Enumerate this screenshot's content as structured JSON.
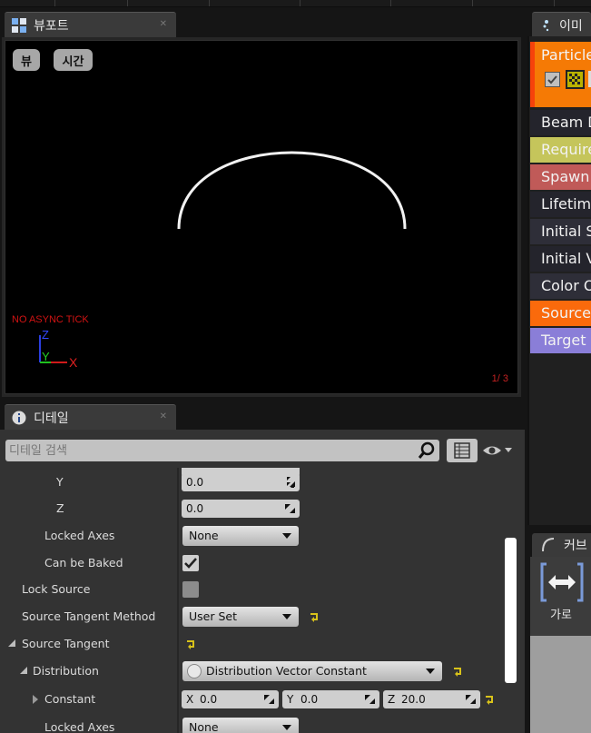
{
  "viewport": {
    "tab_title": "뷰포트",
    "view_button": "뷰",
    "time_button": "시간",
    "overlay_text": "NO ASYNC TICK",
    "axis_z": "Z",
    "axis_y": "Y",
    "axis_x": "X",
    "page_indicator": "1/  3"
  },
  "details": {
    "tab_title": "디테일",
    "search_placeholder": "디테일 검색",
    "rows": {
      "y_label": "Y",
      "y_value": "0.0",
      "z_label": "Z",
      "z_value": "0.0",
      "locked_axes_label": "Locked Axes",
      "locked_axes_value": "None",
      "can_be_baked_label": "Can be Baked",
      "lock_source_label": "Lock Source",
      "source_tangent_method_label": "Source Tangent Method",
      "source_tangent_method_value": "User Set",
      "source_tangent_label": "Source Tangent",
      "distribution_label": "Distribution",
      "distribution_value": "Distribution Vector Constant",
      "constant_label": "Constant",
      "constant_x_label": "X",
      "constant_x": "0.0",
      "constant_y_label": "Y",
      "constant_y": "0.0",
      "constant_z_label": "Z",
      "constant_z": "20.0",
      "locked_axes2_label": "Locked Axes",
      "locked_axes2_value": "None"
    }
  },
  "emitters": {
    "tab_title": "이미",
    "emitter_name": "Particle",
    "modules": [
      {
        "label": "Beam D",
        "color": "#24242c"
      },
      {
        "label": "Require",
        "color": "#c5c55b"
      },
      {
        "label": "Spawn",
        "color": "#c05a58"
      },
      {
        "label": "Lifetime",
        "color": "#24242c"
      },
      {
        "label": "Initial S",
        "color": "#2e2e38"
      },
      {
        "label": "Initial V",
        "color": "#24242c"
      },
      {
        "label": "Color O",
        "color": "#2e2e38"
      },
      {
        "label": "Source",
        "color": "#fa6a0c"
      },
      {
        "label": "Target",
        "color": "#8a7ed8"
      }
    ]
  },
  "curve_editor": {
    "tab_title": "커브",
    "horizontal_label": "가로"
  }
}
